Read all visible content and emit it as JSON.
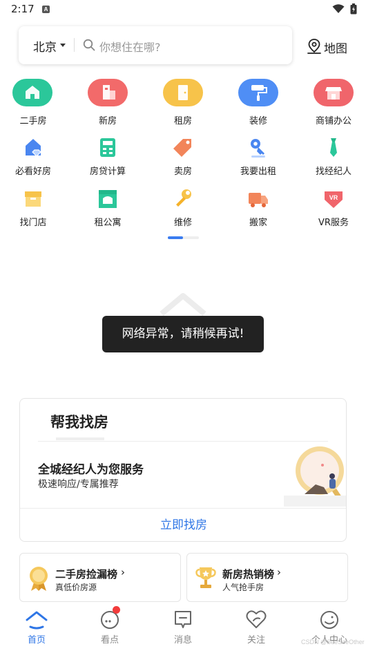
{
  "status_bar": {
    "time": "2:17",
    "notification_icon": "a-icon",
    "icons": [
      "wifi-icon",
      "battery-icon"
    ]
  },
  "search": {
    "city": "北京",
    "placeholder": "你想住在哪?",
    "map_label": "地图"
  },
  "primary_nav": [
    {
      "label": "二手房",
      "icon": "house-icon",
      "color": "#2bc79a"
    },
    {
      "label": "新房",
      "icon": "building-icon",
      "color": "#f26a6a"
    },
    {
      "label": "租房",
      "icon": "door-icon",
      "color": "#f7c34a"
    },
    {
      "label": "装修",
      "icon": "paint-roller-icon",
      "color": "#4f8ef5"
    },
    {
      "label": "商铺办公",
      "icon": "shop-icon",
      "color": "#f0656b"
    }
  ],
  "secondary_nav": [
    {
      "label": "必看好房",
      "icon": "diamond-house-icon"
    },
    {
      "label": "房贷计算",
      "icon": "calculator-icon"
    },
    {
      "label": "卖房",
      "icon": "price-tag-icon"
    },
    {
      "label": "我要出租",
      "icon": "key-icon"
    },
    {
      "label": "找经纪人",
      "icon": "tie-icon"
    },
    {
      "label": "找门店",
      "icon": "store-icon"
    },
    {
      "label": "租公寓",
      "icon": "apartment-icon"
    },
    {
      "label": "维修",
      "icon": "wrench-icon"
    },
    {
      "label": "搬家",
      "icon": "truck-icon"
    },
    {
      "label": "VR服务",
      "icon": "vr-icon"
    }
  ],
  "pager": {
    "pages": 2,
    "active": 1
  },
  "toast": "网络异常，请稍候再试!",
  "find_card": {
    "title": "帮我找房",
    "headline": "全城经纪人为您服务",
    "subtitle": "极速响应/专属推荐",
    "button": "立即找房"
  },
  "rankings": [
    {
      "title": "二手房捡漏榜",
      "subtitle": "真低价房源",
      "icon": "medal-icon"
    },
    {
      "title": "新房热销榜",
      "subtitle": "人气抢手房",
      "icon": "trophy-icon"
    }
  ],
  "tabbar": [
    {
      "label": "首页",
      "icon": "home-icon",
      "active": true
    },
    {
      "label": "看点",
      "icon": "discover-icon",
      "badge": true
    },
    {
      "label": "消息",
      "icon": "message-icon"
    },
    {
      "label": "关注",
      "icon": "heart-icon"
    },
    {
      "label": "个人中心",
      "icon": "profile-icon"
    }
  ],
  "watermark": "CSDN @SeeSeeOther",
  "colors": {
    "accent": "#2f76e6",
    "toast_bg": "#222222",
    "badge": "#f23b3b"
  }
}
